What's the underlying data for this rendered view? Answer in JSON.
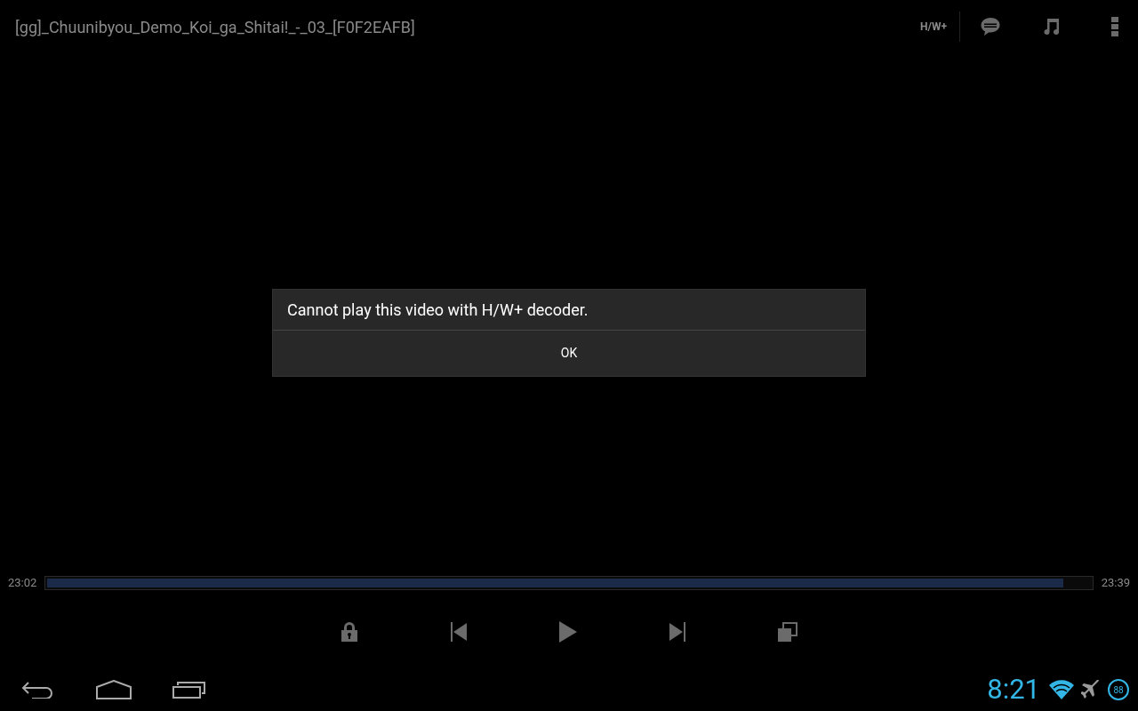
{
  "title": "[gg]_Chuunibyou_Demo_Koi_ga_Shitai!_-_03_[F0F2EAFB]",
  "decoder_button": "H/W+",
  "dialog": {
    "message": "Cannot play this video with H/W+ decoder.",
    "button": "OK"
  },
  "seek_bar": {
    "elapsed": "23:02",
    "total": "23:39",
    "level": 0.974
  },
  "status_bar": {
    "time": "8:21",
    "battery": "88"
  }
}
